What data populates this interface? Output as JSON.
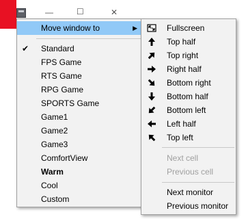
{
  "background_window": {
    "controls": {
      "minimize": "—",
      "maximize": "☐",
      "close": "✕"
    }
  },
  "main_menu": {
    "items": [
      {
        "label": "Move window to",
        "has_submenu": true,
        "highlighted": true
      },
      {
        "label": "Standard",
        "checked": true
      },
      {
        "label": "FPS Game"
      },
      {
        "label": "RTS Game"
      },
      {
        "label": "RPG Game"
      },
      {
        "label": "SPORTS Game"
      },
      {
        "label": "Game1"
      },
      {
        "label": "Game2"
      },
      {
        "label": "Game3"
      },
      {
        "label": "ComfortView"
      },
      {
        "label": "Warm",
        "bold": true
      },
      {
        "label": "Cool"
      },
      {
        "label": "Custom"
      }
    ],
    "check_glyph": "✔",
    "submenu_glyph": "▶"
  },
  "submenu": {
    "items": [
      {
        "label": "Fullscreen",
        "icon": "fullscreen-icon"
      },
      {
        "label": "Top half",
        "icon": "arrow-up-icon"
      },
      {
        "label": "Top right",
        "icon": "arrow-up-right-icon"
      },
      {
        "label": "Right half",
        "icon": "arrow-right-icon"
      },
      {
        "label": "Bottom right",
        "icon": "arrow-down-right-icon"
      },
      {
        "label": "Bottom half",
        "icon": "arrow-down-icon"
      },
      {
        "label": "Bottom left",
        "icon": "arrow-down-left-icon"
      },
      {
        "label": "Left half",
        "icon": "arrow-left-icon"
      },
      {
        "label": "Top left",
        "icon": "arrow-up-left-icon"
      },
      {
        "label": "Next cell",
        "disabled": true
      },
      {
        "label": "Previous cell",
        "disabled": true
      },
      {
        "label": "Next monitor"
      },
      {
        "label": "Previous monitor"
      }
    ]
  },
  "colors": {
    "menu_bg": "#f2f2f2",
    "highlight": "#91c9f7",
    "disabled_text": "#a0a0a0",
    "titlebar_red": "#e81123"
  }
}
